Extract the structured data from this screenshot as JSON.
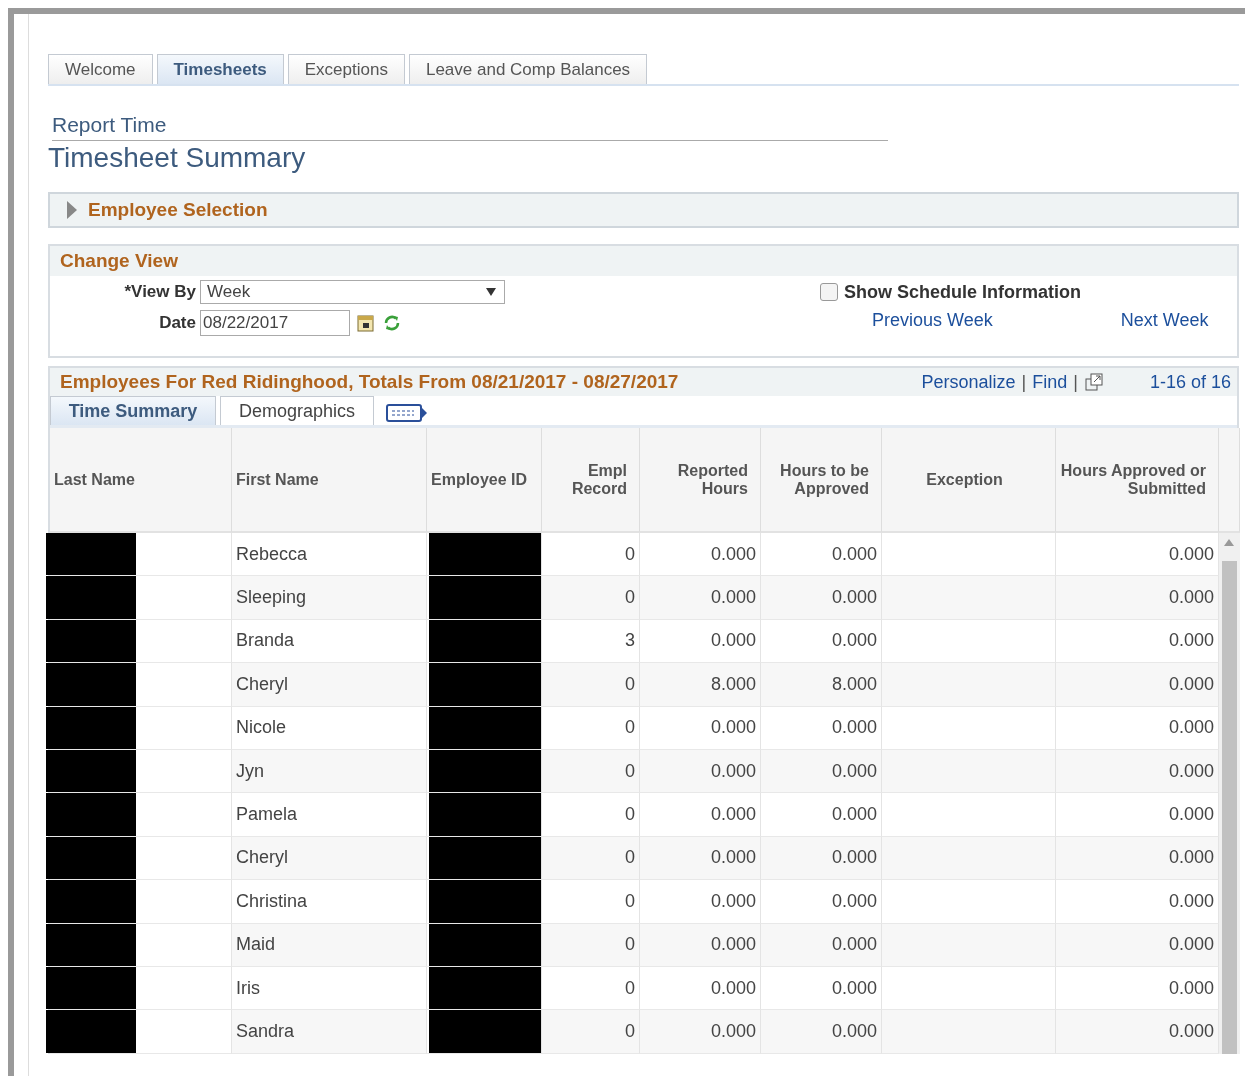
{
  "tabs": [
    {
      "label": "Welcome",
      "selected": false
    },
    {
      "label": "Timesheets",
      "selected": true
    },
    {
      "label": "Exceptions",
      "selected": false
    },
    {
      "label": "Leave and Comp Balances",
      "selected": false
    }
  ],
  "breadcrumb": "Report Time",
  "title": "Timesheet Summary",
  "employee_selection": {
    "label": "Employee Selection",
    "expanded": false
  },
  "change_view": {
    "title": "Change View",
    "view_by_label": "*View By",
    "view_by_value": "Week",
    "date_label": "Date",
    "date_value": "08/22/2017",
    "show_schedule": {
      "label": "Show Schedule Information",
      "checked": false
    },
    "previous_link": "Previous Week",
    "next_link": "Next Week"
  },
  "grid": {
    "title": "Employees For Red Ridinghood, Totals From 08/21/2017 - 08/27/2017",
    "personalize": "Personalize",
    "separator": "|",
    "find": "Find",
    "count": "1-16 of 16",
    "subtabs": [
      {
        "label": "Time Summary",
        "selected": true
      },
      {
        "label": "Demographics",
        "selected": false
      }
    ],
    "columns": [
      {
        "label": "Last Name",
        "kind": "hidden"
      },
      {
        "label": "First Name",
        "kind": "text"
      },
      {
        "label": "Employee ID",
        "kind": "hidden"
      },
      {
        "label": "Empl Record",
        "kind": "number"
      },
      {
        "label": "Reported Hours",
        "kind": "number"
      },
      {
        "label": "Hours to be Approved",
        "kind": "number"
      },
      {
        "label": "Exception",
        "kind": "flag"
      },
      {
        "label": "Hours Approved or Submitted",
        "kind": "number"
      }
    ],
    "rows": [
      [
        "",
        "Rebecca",
        "",
        "0",
        "0.000",
        "0.000",
        "",
        "0.000"
      ],
      [
        "",
        "Sleeping",
        "",
        "0",
        "0.000",
        "0.000",
        "",
        "0.000"
      ],
      [
        "",
        "Branda",
        "",
        "3",
        "0.000",
        "0.000",
        "",
        "0.000"
      ],
      [
        "",
        "Cheryl",
        "",
        "0",
        "8.000",
        "8.000",
        "",
        "0.000"
      ],
      [
        "",
        "Nicole",
        "",
        "0",
        "0.000",
        "0.000",
        "",
        "0.000"
      ],
      [
        "",
        "Jyn",
        "",
        "0",
        "0.000",
        "0.000",
        "",
        "0.000"
      ],
      [
        "",
        "Pamela",
        "",
        "0",
        "0.000",
        "0.000",
        "",
        "0.000"
      ],
      [
        "",
        "Cheryl",
        "",
        "0",
        "0.000",
        "0.000",
        "",
        "0.000"
      ],
      [
        "",
        "Christina",
        "",
        "0",
        "0.000",
        "0.000",
        "",
        "0.000"
      ],
      [
        "",
        "Maid",
        "",
        "0",
        "0.000",
        "0.000",
        "",
        "0.000"
      ],
      [
        "",
        "Iris",
        "",
        "0",
        "0.000",
        "0.000",
        "",
        "0.000"
      ],
      [
        "",
        "Sandra",
        "",
        "0",
        "0.000",
        "0.000",
        "",
        "0.000"
      ]
    ]
  }
}
